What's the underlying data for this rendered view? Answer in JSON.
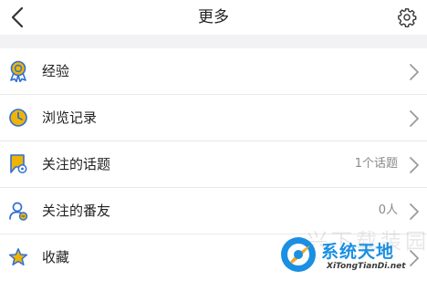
{
  "header": {
    "title": "更多"
  },
  "menu": {
    "items": [
      {
        "label": "经验",
        "value": "",
        "icon": "medal-icon",
        "icon_color": "#f0b400"
      },
      {
        "label": "浏览记录",
        "value": "",
        "icon": "clock-icon",
        "icon_color": "#f0b400"
      },
      {
        "label": "关注的话题",
        "value": "1个话题",
        "icon": "topic-flag-icon",
        "icon_color": "#f0b400"
      },
      {
        "label": "关注的番友",
        "value": "0人",
        "icon": "user-follow-icon",
        "icon_color": "#2f6fd8"
      },
      {
        "label": "收藏",
        "value": "",
        "icon": "star-icon",
        "icon_color": "#2f6fd8"
      }
    ]
  },
  "watermark": {
    "faint_text": "兴下载装园",
    "site_name": "系统天地",
    "site_url": "XiTongTianDi.net"
  },
  "colors": {
    "accent_yellow": "#f0b400",
    "accent_blue": "#2f6fd8",
    "watermark_blue": "#1a8fe3"
  }
}
